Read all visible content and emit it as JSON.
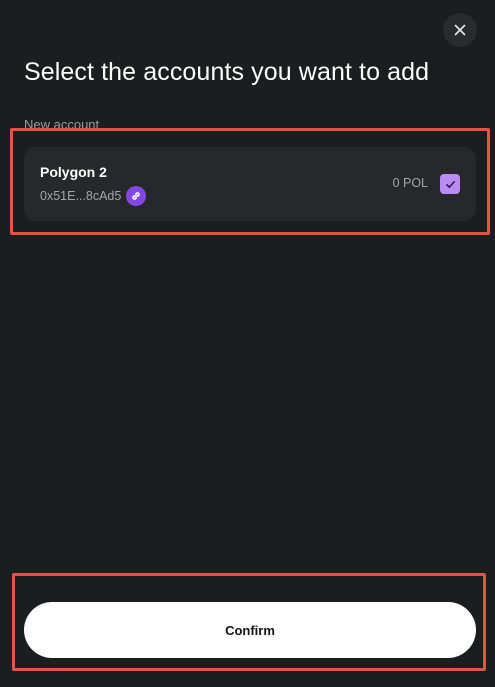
{
  "modal": {
    "title": "Select the accounts you want to add",
    "close_icon": "close-icon"
  },
  "section": {
    "label": "New account"
  },
  "accounts": [
    {
      "name": "Polygon 2",
      "address": "0x51E...8cAd5",
      "network_icon": "link-icon",
      "network_color": "#8247e5",
      "balance": "0 POL",
      "selected": true,
      "checkbox_color": "#b98cf5"
    }
  ],
  "footer": {
    "confirm_label": "Confirm"
  },
  "highlight_color": "#e5534b"
}
